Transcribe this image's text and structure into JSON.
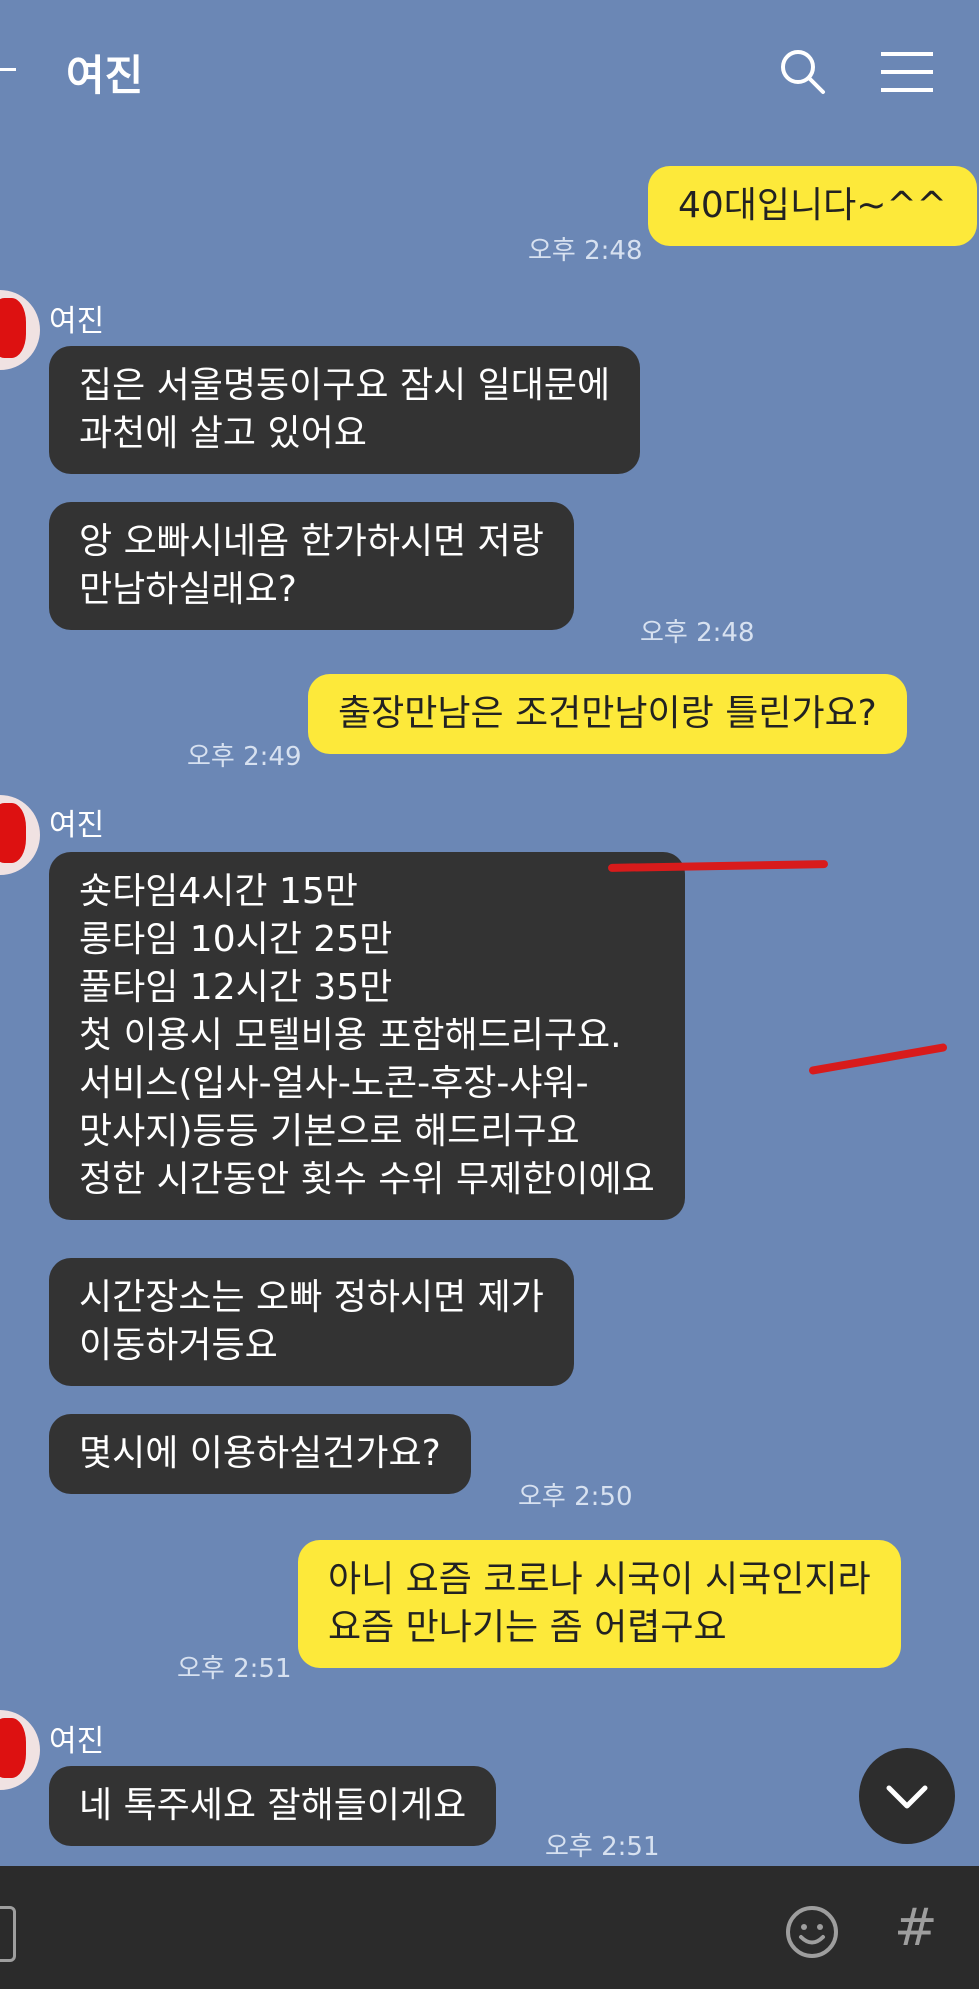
{
  "header": {
    "title": "여진"
  },
  "icons": {
    "back": "back-icon",
    "search": "search-icon",
    "menu": "menu-icon",
    "scroll_down": "chevron-down-icon",
    "emoji": "emoji-icon",
    "hashtag": "hashtag-icon"
  },
  "colors": {
    "background": "#6b87b5",
    "incoming_bubble": "#333333",
    "outgoing_bubble": "#fde93a"
  },
  "messages": [
    {
      "id": "m1",
      "type": "out",
      "text": "40대입니다~^^",
      "time": "오후 2:48"
    },
    {
      "id": "m2",
      "type": "in",
      "sender": "여진",
      "text": "집은 서울명동이구요 잠시 일대문에\n과천에 살고 있어요"
    },
    {
      "id": "m3",
      "type": "in",
      "text": "앙 오빠시네욤 한가하시면 저랑\n만남하실래요?",
      "time": "오후 2:48"
    },
    {
      "id": "m4",
      "type": "out",
      "text": "출장만남은 조건만남이랑 틀린가요?",
      "time": "오후 2:49"
    },
    {
      "id": "m5",
      "type": "in",
      "sender": "여진",
      "text": "숏타임4시간 15만\n롱타임 10시간 25만\n풀타임 12시간 35만\n첫 이용시 모텔비용 포함해드리구요.\n서비스(입사-얼사-노콘-후장-샤워-\n맛사지)등등 기본으로 해드리구요\n정한 시간동안 횟수 수위 무제한이에요"
    },
    {
      "id": "m6",
      "type": "in",
      "text": "시간장소는 오빠 정하시면 제가\n이동하거등요"
    },
    {
      "id": "m7",
      "type": "in",
      "text": "몇시에 이용하실건가요?",
      "time": "오후 2:50"
    },
    {
      "id": "m8",
      "type": "out",
      "text": "아니 요즘 코로나 시국이 시국인지라\n요즘 만나기는 좀 어렵구요",
      "time": "오후 2:51"
    },
    {
      "id": "m9",
      "type": "in",
      "sender": "여진",
      "text": "네 톡주세요 잘해들이게요",
      "time": "오후 2:51"
    }
  ]
}
